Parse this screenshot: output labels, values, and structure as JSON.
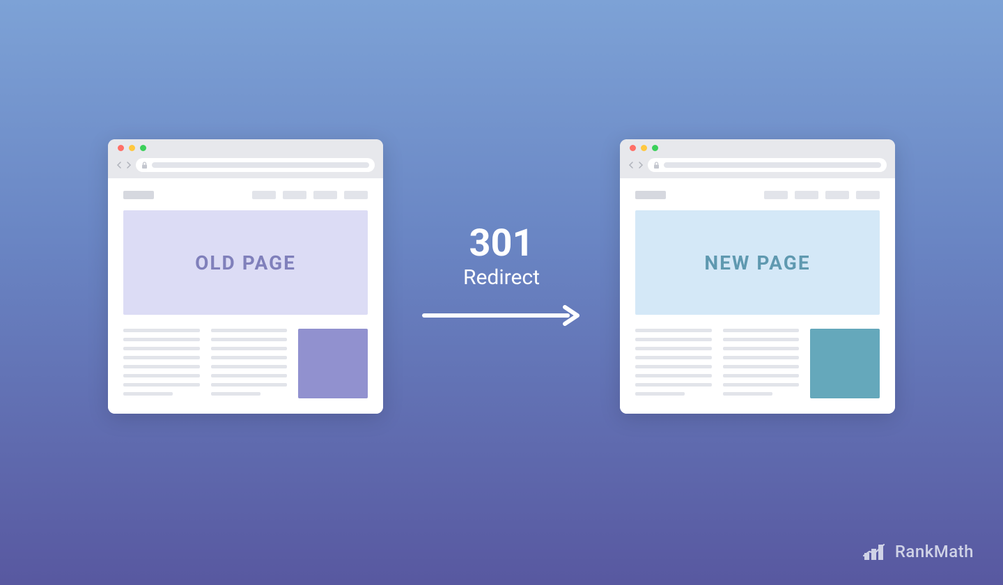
{
  "left": {
    "hero_label": "OLD PAGE"
  },
  "right": {
    "hero_label": "NEW PAGE"
  },
  "center": {
    "code": "301",
    "word": "Redirect"
  },
  "brand": {
    "name": "RankMath"
  }
}
